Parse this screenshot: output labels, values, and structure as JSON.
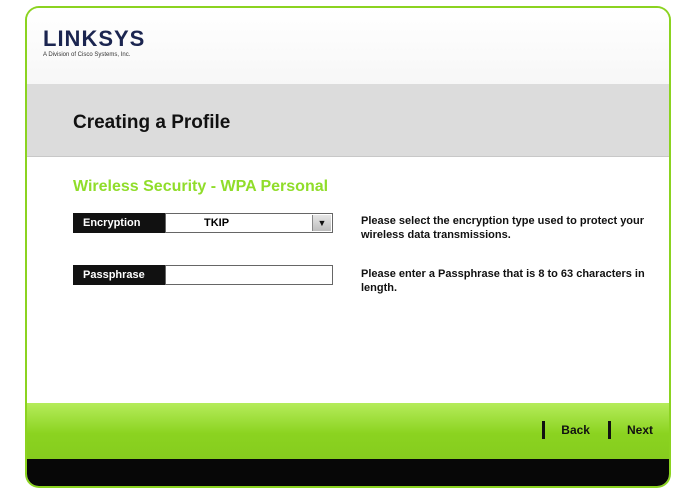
{
  "brand": {
    "name": "LINKSYS",
    "tagline": "A Division of Cisco Systems, Inc."
  },
  "header": {
    "title": "Creating a Profile"
  },
  "section": {
    "title": "Wireless Security - WPA Personal"
  },
  "encryption": {
    "label": "Encryption",
    "value": "TKIP",
    "help": "Please select the encryption type used to protect your wireless data transmissions."
  },
  "passphrase": {
    "label": "Passphrase",
    "value": "",
    "help": "Please enter a Passphrase that is 8 to 63 characters in length."
  },
  "nav": {
    "back_label": "Back",
    "next_label": "Next"
  },
  "colors": {
    "accent_green": "#8bd320",
    "section_title_green": "#90dd2a",
    "label_background": "#111111"
  },
  "icons": {
    "dropdown": "triangle-down-icon"
  }
}
